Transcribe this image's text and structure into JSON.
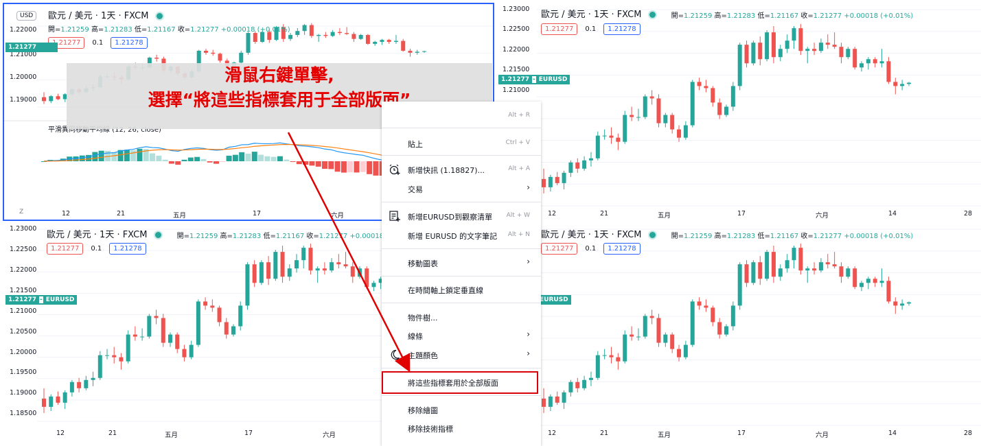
{
  "instrument": {
    "title": "歐元 / 美元 · 1天 · FXCM",
    "ohlc": [
      {
        "label": "開=",
        "value": "1.21259"
      },
      {
        "label": "高=",
        "value": "1.21283"
      },
      {
        "label": "低=",
        "value": "1.21167"
      },
      {
        "label": "收=",
        "value": "1.21277"
      },
      {
        "label": "",
        "value": "+0.00018 (+0.01%)"
      }
    ],
    "bid": "1.21277",
    "spread": "0.1",
    "ask": "1.21278",
    "price_badge": "1.21277",
    "symbol_badge": "EURUSD",
    "currency": "USD",
    "zoom_button": "Z"
  },
  "x_axis": [
    "12",
    "21",
    "五月",
    "17",
    "六月",
    "14",
    "28"
  ],
  "y_axis_full": [
    "1.23000",
    "1.22500",
    "1.22000",
    "1.21500",
    "1.21000",
    "1.20500",
    "1.20000",
    "1.19500",
    "1.19000",
    "1.18500"
  ],
  "y_axis_small": [
    "1.22000",
    "1.21000",
    "1.20000",
    "1.19000"
  ],
  "indicator_title": "平滑異同移動平均線 (12, 26, close)",
  "callout": {
    "line1": "滑鼠右鍵單擊,",
    "line2": "選擇“將這些指標套用于全部版面”"
  },
  "context_menu": [
    {
      "label": "",
      "shortcut": "Alt + R",
      "icon": ""
    },
    {
      "label": "貼上",
      "shortcut": "Ctrl + V",
      "icon": ""
    },
    {
      "label": "新增快訊 (1.18827)...",
      "shortcut": "Alt + A",
      "icon": "alarm-clock-icon"
    },
    {
      "label": "交易",
      "shortcut": "",
      "icon": ""
    },
    {
      "label": "新增EURUSD到觀察清單",
      "shortcut": "Alt + W",
      "icon": "watchlist-add-icon"
    },
    {
      "label": "新增 EURUSD 的文字筆記",
      "shortcut": "Alt + N",
      "icon": ""
    },
    {
      "label": "移動圖表",
      "shortcut": "",
      "icon": ""
    },
    {
      "label": "在時間軸上鎖定垂直線",
      "shortcut": "",
      "icon": ""
    },
    {
      "label": "物件樹...",
      "shortcut": "",
      "icon": ""
    },
    {
      "label": "線條",
      "shortcut": "",
      "icon": ""
    },
    {
      "label": "主題顏色",
      "shortcut": "",
      "icon": "moon-icon"
    },
    {
      "label": "將這些指標套用於全部版面",
      "shortcut": "",
      "icon": ""
    },
    {
      "label": "移除繪圖",
      "shortcut": "",
      "icon": ""
    },
    {
      "label": "移除技術指標",
      "shortcut": "",
      "icon": ""
    }
  ],
  "colors": {
    "up": "#26a69a",
    "down": "#ef5350",
    "macd_line": "#2196f3",
    "signal_line": "#ff7f0e",
    "hist_up_strong": "#26a69a",
    "hist_up_weak": "#b2dfdb",
    "hist_down_strong": "#ef5350",
    "hist_down_weak": "#ffcdd2",
    "callout_text": "#e50000",
    "highlight_border": "#d9000a"
  },
  "candles": [
    [
      1.1895,
      1.192,
      1.186,
      1.1875
    ],
    [
      1.1875,
      1.1905,
      1.1865,
      1.19
    ],
    [
      1.19,
      1.1912,
      1.188,
      1.1885
    ],
    [
      1.1885,
      1.1915,
      1.187,
      1.191
    ],
    [
      1.191,
      1.194,
      1.19,
      1.1935
    ],
    [
      1.1935,
      1.1945,
      1.191,
      1.192
    ],
    [
      1.192,
      1.195,
      1.1915,
      1.194
    ],
    [
      1.194,
      1.196,
      1.1925,
      1.1945
    ],
    [
      1.1945,
      1.201,
      1.194,
      1.2
    ],
    [
      1.2,
      1.2015,
      1.199,
      1.2
    ],
    [
      1.2,
      1.202,
      1.198,
      1.1995
    ],
    [
      1.1995,
      1.2005,
      1.1965,
      1.1985
    ],
    [
      1.1985,
      1.206,
      1.198,
      1.205
    ],
    [
      1.205,
      1.207,
      1.2035,
      1.2045
    ],
    [
      1.2045,
      1.2065,
      1.2035,
      1.2045
    ],
    [
      1.2045,
      1.21,
      1.204,
      1.2095
    ],
    [
      1.2095,
      1.211,
      1.2075,
      1.209
    ],
    [
      1.209,
      1.21,
      1.202,
      1.203
    ],
    [
      1.203,
      1.2055,
      1.202,
      1.205
    ],
    [
      1.205,
      1.2055,
      1.2005,
      1.2015
    ],
    [
      1.2015,
      1.2025,
      1.1985,
      1.1995
    ],
    [
      1.1995,
      1.2035,
      1.199,
      1.2025
    ],
    [
      1.2025,
      1.2135,
      1.202,
      1.213
    ],
    [
      1.213,
      1.214,
      1.211,
      1.212
    ],
    [
      1.212,
      1.2135,
      1.2105,
      1.2115
    ],
    [
      1.2115,
      1.212,
      1.207,
      1.208
    ],
    [
      1.208,
      1.209,
      1.204,
      1.205
    ],
    [
      1.205,
      1.2075,
      1.2045,
      1.207
    ],
    [
      1.207,
      1.213,
      1.206,
      1.212
    ],
    [
      1.212,
      1.2225,
      1.211,
      1.222
    ],
    [
      1.222,
      1.223,
      1.2165,
      1.2175
    ],
    [
      1.2175,
      1.223,
      1.217,
      1.2225
    ],
    [
      1.2225,
      1.224,
      1.217,
      1.2185
    ],
    [
      1.2185,
      1.2255,
      1.218,
      1.225
    ],
    [
      1.225,
      1.2265,
      1.2175,
      1.219
    ],
    [
      1.219,
      1.222,
      1.218,
      1.221
    ],
    [
      1.221,
      1.2245,
      1.22,
      1.223
    ],
    [
      1.223,
      1.2265,
      1.221,
      1.226
    ],
    [
      1.226,
      1.227,
      1.2195,
      1.2205
    ],
    [
      1.2205,
      1.2215,
      1.2175,
      1.221
    ],
    [
      1.221,
      1.2225,
      1.2195,
      1.2205
    ],
    [
      1.2205,
      1.2235,
      1.22,
      1.2225
    ],
    [
      1.2225,
      1.2245,
      1.221,
      1.222
    ],
    [
      1.222,
      1.225,
      1.221,
      1.2215
    ],
    [
      1.2215,
      1.2225,
      1.2175,
      1.219
    ],
    [
      1.219,
      1.2215,
      1.2185,
      1.221
    ],
    [
      1.221,
      1.2215,
      1.216,
      1.2165
    ],
    [
      1.2165,
      1.218,
      1.2155,
      1.2175
    ],
    [
      1.2175,
      1.219,
      1.216,
      1.2185
    ],
    [
      1.2185,
      1.219,
      1.2165,
      1.2175
    ],
    [
      1.2175,
      1.221,
      1.2165,
      1.218
    ],
    [
      1.218,
      1.219,
      1.2125,
      1.213
    ],
    [
      1.213,
      1.214,
      1.21,
      1.212
    ],
    [
      1.212,
      1.2135,
      1.211,
      1.2125
    ],
    [
      1.2125,
      1.213,
      1.212,
      1.2128
    ]
  ]
}
